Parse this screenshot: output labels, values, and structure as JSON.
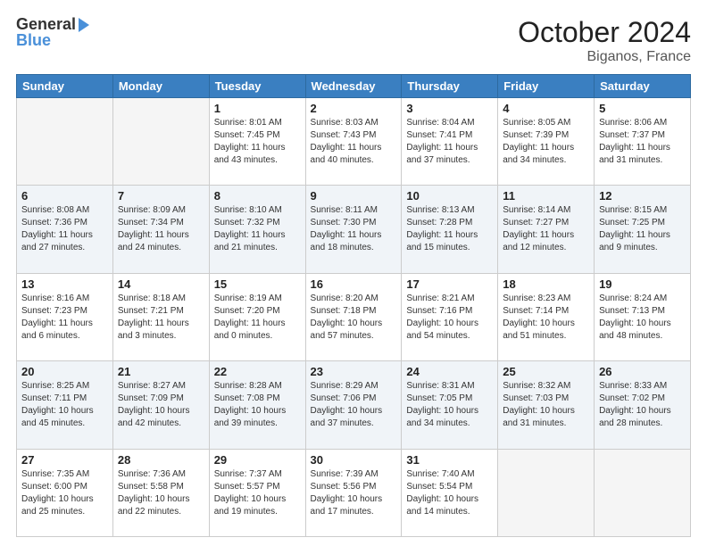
{
  "header": {
    "logo_line1": "General",
    "logo_line2": "Blue",
    "month": "October 2024",
    "location": "Biganos, France"
  },
  "weekdays": [
    "Sunday",
    "Monday",
    "Tuesday",
    "Wednesday",
    "Thursday",
    "Friday",
    "Saturday"
  ],
  "weeks": [
    [
      {
        "day": "",
        "text": ""
      },
      {
        "day": "",
        "text": ""
      },
      {
        "day": "1",
        "text": "Sunrise: 8:01 AM\nSunset: 7:45 PM\nDaylight: 11 hours and 43 minutes."
      },
      {
        "day": "2",
        "text": "Sunrise: 8:03 AM\nSunset: 7:43 PM\nDaylight: 11 hours and 40 minutes."
      },
      {
        "day": "3",
        "text": "Sunrise: 8:04 AM\nSunset: 7:41 PM\nDaylight: 11 hours and 37 minutes."
      },
      {
        "day": "4",
        "text": "Sunrise: 8:05 AM\nSunset: 7:39 PM\nDaylight: 11 hours and 34 minutes."
      },
      {
        "day": "5",
        "text": "Sunrise: 8:06 AM\nSunset: 7:37 PM\nDaylight: 11 hours and 31 minutes."
      }
    ],
    [
      {
        "day": "6",
        "text": "Sunrise: 8:08 AM\nSunset: 7:36 PM\nDaylight: 11 hours and 27 minutes."
      },
      {
        "day": "7",
        "text": "Sunrise: 8:09 AM\nSunset: 7:34 PM\nDaylight: 11 hours and 24 minutes."
      },
      {
        "day": "8",
        "text": "Sunrise: 8:10 AM\nSunset: 7:32 PM\nDaylight: 11 hours and 21 minutes."
      },
      {
        "day": "9",
        "text": "Sunrise: 8:11 AM\nSunset: 7:30 PM\nDaylight: 11 hours and 18 minutes."
      },
      {
        "day": "10",
        "text": "Sunrise: 8:13 AM\nSunset: 7:28 PM\nDaylight: 11 hours and 15 minutes."
      },
      {
        "day": "11",
        "text": "Sunrise: 8:14 AM\nSunset: 7:27 PM\nDaylight: 11 hours and 12 minutes."
      },
      {
        "day": "12",
        "text": "Sunrise: 8:15 AM\nSunset: 7:25 PM\nDaylight: 11 hours and 9 minutes."
      }
    ],
    [
      {
        "day": "13",
        "text": "Sunrise: 8:16 AM\nSunset: 7:23 PM\nDaylight: 11 hours and 6 minutes."
      },
      {
        "day": "14",
        "text": "Sunrise: 8:18 AM\nSunset: 7:21 PM\nDaylight: 11 hours and 3 minutes."
      },
      {
        "day": "15",
        "text": "Sunrise: 8:19 AM\nSunset: 7:20 PM\nDaylight: 11 hours and 0 minutes."
      },
      {
        "day": "16",
        "text": "Sunrise: 8:20 AM\nSunset: 7:18 PM\nDaylight: 10 hours and 57 minutes."
      },
      {
        "day": "17",
        "text": "Sunrise: 8:21 AM\nSunset: 7:16 PM\nDaylight: 10 hours and 54 minutes."
      },
      {
        "day": "18",
        "text": "Sunrise: 8:23 AM\nSunset: 7:14 PM\nDaylight: 10 hours and 51 minutes."
      },
      {
        "day": "19",
        "text": "Sunrise: 8:24 AM\nSunset: 7:13 PM\nDaylight: 10 hours and 48 minutes."
      }
    ],
    [
      {
        "day": "20",
        "text": "Sunrise: 8:25 AM\nSunset: 7:11 PM\nDaylight: 10 hours and 45 minutes."
      },
      {
        "day": "21",
        "text": "Sunrise: 8:27 AM\nSunset: 7:09 PM\nDaylight: 10 hours and 42 minutes."
      },
      {
        "day": "22",
        "text": "Sunrise: 8:28 AM\nSunset: 7:08 PM\nDaylight: 10 hours and 39 minutes."
      },
      {
        "day": "23",
        "text": "Sunrise: 8:29 AM\nSunset: 7:06 PM\nDaylight: 10 hours and 37 minutes."
      },
      {
        "day": "24",
        "text": "Sunrise: 8:31 AM\nSunset: 7:05 PM\nDaylight: 10 hours and 34 minutes."
      },
      {
        "day": "25",
        "text": "Sunrise: 8:32 AM\nSunset: 7:03 PM\nDaylight: 10 hours and 31 minutes."
      },
      {
        "day": "26",
        "text": "Sunrise: 8:33 AM\nSunset: 7:02 PM\nDaylight: 10 hours and 28 minutes."
      }
    ],
    [
      {
        "day": "27",
        "text": "Sunrise: 7:35 AM\nSunset: 6:00 PM\nDaylight: 10 hours and 25 minutes."
      },
      {
        "day": "28",
        "text": "Sunrise: 7:36 AM\nSunset: 5:58 PM\nDaylight: 10 hours and 22 minutes."
      },
      {
        "day": "29",
        "text": "Sunrise: 7:37 AM\nSunset: 5:57 PM\nDaylight: 10 hours and 19 minutes."
      },
      {
        "day": "30",
        "text": "Sunrise: 7:39 AM\nSunset: 5:56 PM\nDaylight: 10 hours and 17 minutes."
      },
      {
        "day": "31",
        "text": "Sunrise: 7:40 AM\nSunset: 5:54 PM\nDaylight: 10 hours and 14 minutes."
      },
      {
        "day": "",
        "text": ""
      },
      {
        "day": "",
        "text": ""
      }
    ]
  ]
}
